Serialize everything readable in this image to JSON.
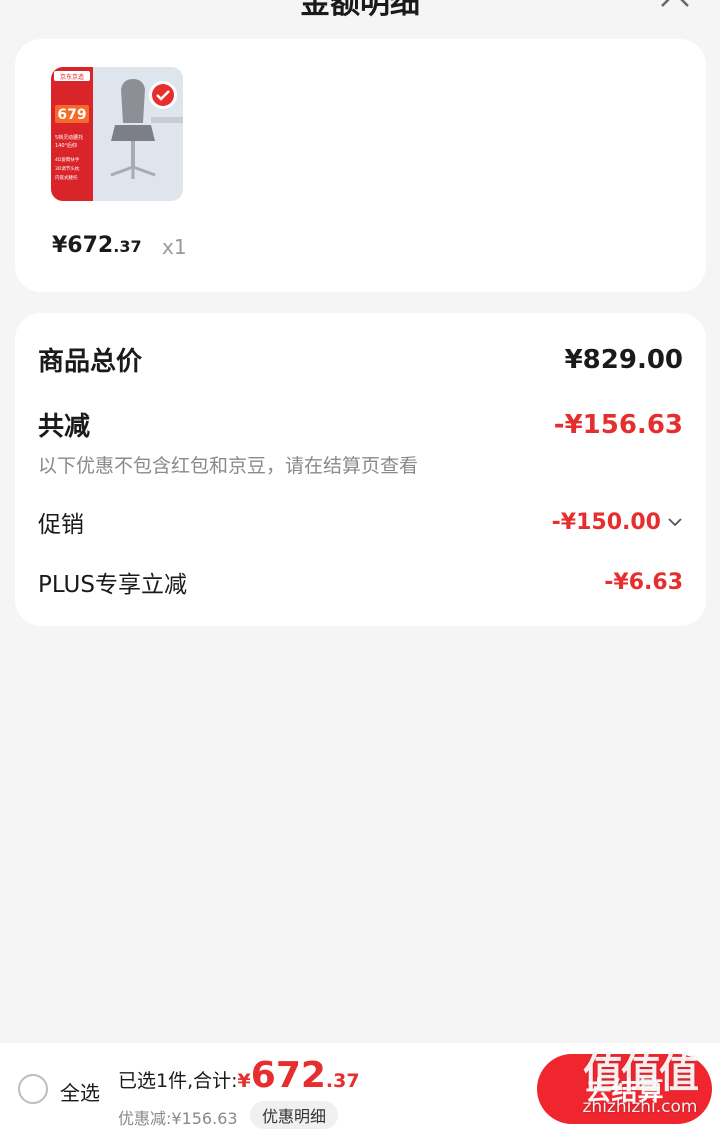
{
  "header": {
    "title": "金额明细"
  },
  "product": {
    "price_int": "¥672",
    "price_cents": ".37",
    "quantity": "x1",
    "thumb": {
      "badge_text": "京东京造",
      "promo_price": "679",
      "line1": "5档灵动腰托",
      "line2": "140°后仰",
      "spec1": "4D旋臂扶手",
      "spec2": "3D调节头枕",
      "spec3": "内嵌式腰托",
      "check_color": "#e62e2e"
    }
  },
  "summary": {
    "total_label": "商品总价",
    "total_value": "¥829.00",
    "reduce_label": "共减",
    "reduce_value": "-¥156.63",
    "note": "以下优惠不包含红包和京豆，请在结算页查看",
    "promo_label": "促销",
    "promo_value": "-¥150.00",
    "plus_label": "PLUS专享立减",
    "plus_value": "-¥6.63"
  },
  "bottom_bar": {
    "select_all": "全选",
    "selected_label": "已选1件,合计:",
    "total_yen": "¥",
    "total_int": "672",
    "total_cents": ".37",
    "discount_text": "优惠减:¥156.63",
    "detail_button": "优惠明细",
    "checkout_button": "去结算"
  },
  "watermark": {
    "mark": "值值值",
    "url": "zhizhizhi.com"
  },
  "colors": {
    "accent_red": "#e62e2e",
    "checkout_red": "#f0262f",
    "background": "#f5f5f5"
  }
}
